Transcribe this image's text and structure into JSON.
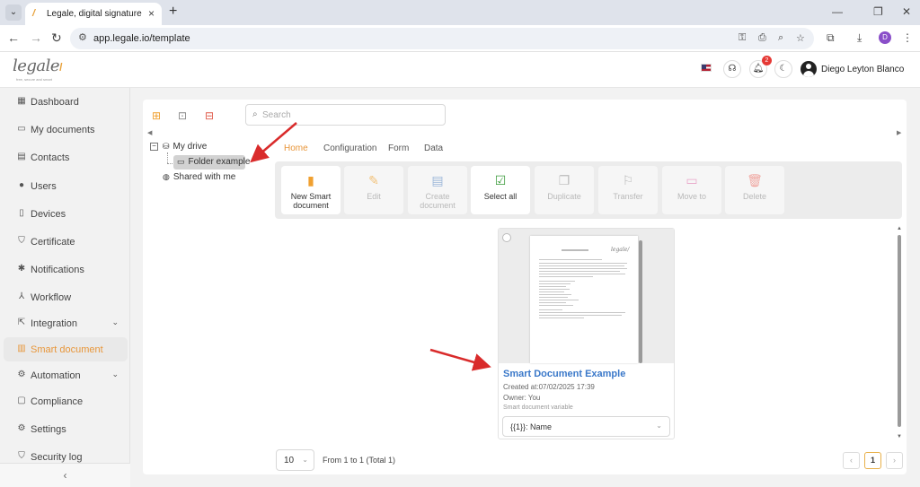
{
  "browser": {
    "tab_title": "Legale, digital signature",
    "url": "app.legale.io/template"
  },
  "header": {
    "logo_text": "legale",
    "logo_tagline": "free, secure and smart",
    "notification_count": "2",
    "user_name": "Diego Leyton Blanco"
  },
  "sidebar": {
    "items": [
      {
        "label": "Dashboard",
        "icon": "dashboard-icon"
      },
      {
        "label": "My documents",
        "icon": "folder-icon"
      },
      {
        "label": "Contacts",
        "icon": "contacts-icon"
      },
      {
        "label": "Users",
        "icon": "user-icon"
      },
      {
        "label": "Devices",
        "icon": "device-icon"
      },
      {
        "label": "Certificate",
        "icon": "shield-icon"
      },
      {
        "label": "Notifications",
        "icon": "bell-icon"
      },
      {
        "label": "Workflow",
        "icon": "workflow-icon"
      },
      {
        "label": "Integration",
        "icon": "external-link-icon"
      },
      {
        "label": "Smart document",
        "icon": "smart-document-icon"
      },
      {
        "label": "Automation",
        "icon": "gear-icon"
      },
      {
        "label": "Compliance",
        "icon": "chat-icon"
      },
      {
        "label": "Settings",
        "icon": "settings-icon"
      },
      {
        "label": "Security log",
        "icon": "security-shield-icon"
      }
    ],
    "active": "Smart document"
  },
  "search": {
    "placeholder": "Search",
    "value": ""
  },
  "tree": {
    "root": "My drive",
    "child": "Folder example",
    "shared": "Shared with me"
  },
  "tabs": [
    "Home",
    "Configuration",
    "Form",
    "Data"
  ],
  "actions": [
    {
      "label_line1": "New Smart",
      "label_line2": "document",
      "enabled": true,
      "color": "#f0a030"
    },
    {
      "label_line1": "Edit",
      "label_line2": "",
      "enabled": false,
      "color": "#f2c27a"
    },
    {
      "label_line1": "Create",
      "label_line2": "document",
      "enabled": false,
      "color": "#9db8d9"
    },
    {
      "label_line1": "Select all",
      "label_line2": "",
      "enabled": true,
      "color": "#3a9a3a"
    },
    {
      "label_line1": "Duplicate",
      "label_line2": "",
      "enabled": false,
      "color": "#bbbbbb"
    },
    {
      "label_line1": "Transfer",
      "label_line2": "",
      "enabled": false,
      "color": "#bbbbbb"
    },
    {
      "label_line1": "Move to",
      "label_line2": "",
      "enabled": false,
      "color": "#e9a6c8"
    },
    {
      "label_line1": "Delete",
      "label_line2": "",
      "enabled": false,
      "color": "#f0a6a0"
    }
  ],
  "card": {
    "title": "Smart Document Example",
    "created": "Created at:07/02/2025 17:39",
    "owner": "Owner: You",
    "variable_label": "Smart document variable",
    "variable_value": "{{1}}: Name"
  },
  "pagination": {
    "page_size": "10",
    "range": "From 1 to 1 (Total 1)",
    "current_page": "1"
  },
  "colors": {
    "accent": "#e8963a",
    "link": "#3a78c9",
    "annotation_arrow": "#d92b2b"
  }
}
